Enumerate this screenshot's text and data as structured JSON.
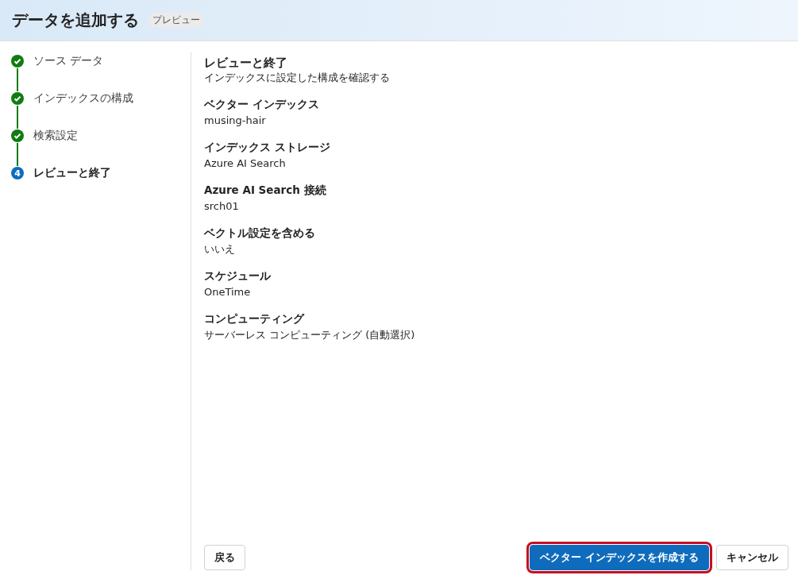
{
  "header": {
    "title": "データを追加する",
    "badge": "プレビュー"
  },
  "steps": [
    {
      "label": "ソース データ",
      "completed": true,
      "selected": false
    },
    {
      "label": "インデックスの構成",
      "completed": true,
      "selected": false
    },
    {
      "label": "検索設定",
      "completed": true,
      "selected": false
    },
    {
      "label": "レビューと終了",
      "completed": false,
      "selected": true,
      "number": "4"
    }
  ],
  "review": {
    "title": "レビューと終了",
    "subtitle": "インデックスに設定した構成を確認する",
    "fields": [
      {
        "label": "ベクター インデックス",
        "value": "musing-hair"
      },
      {
        "label": "インデックス ストレージ",
        "value": "Azure AI Search"
      },
      {
        "label": "Azure AI Search 接続",
        "value": "srch01"
      },
      {
        "label": "ベクトル設定を含める",
        "value": "いいえ"
      },
      {
        "label": "スケジュール",
        "value": "OneTime"
      },
      {
        "label": "コンピューティング",
        "value": "サーバーレス コンピューティング (自動選択)"
      }
    ]
  },
  "buttons": [
    {
      "label": "戻る",
      "kind": "secondary",
      "highlighted": false
    },
    {
      "label": "ベクター インデックスを作成する",
      "kind": "primary",
      "highlighted": true
    },
    {
      "label": "キャンセル",
      "kind": "secondary",
      "highlighted": false
    }
  ]
}
